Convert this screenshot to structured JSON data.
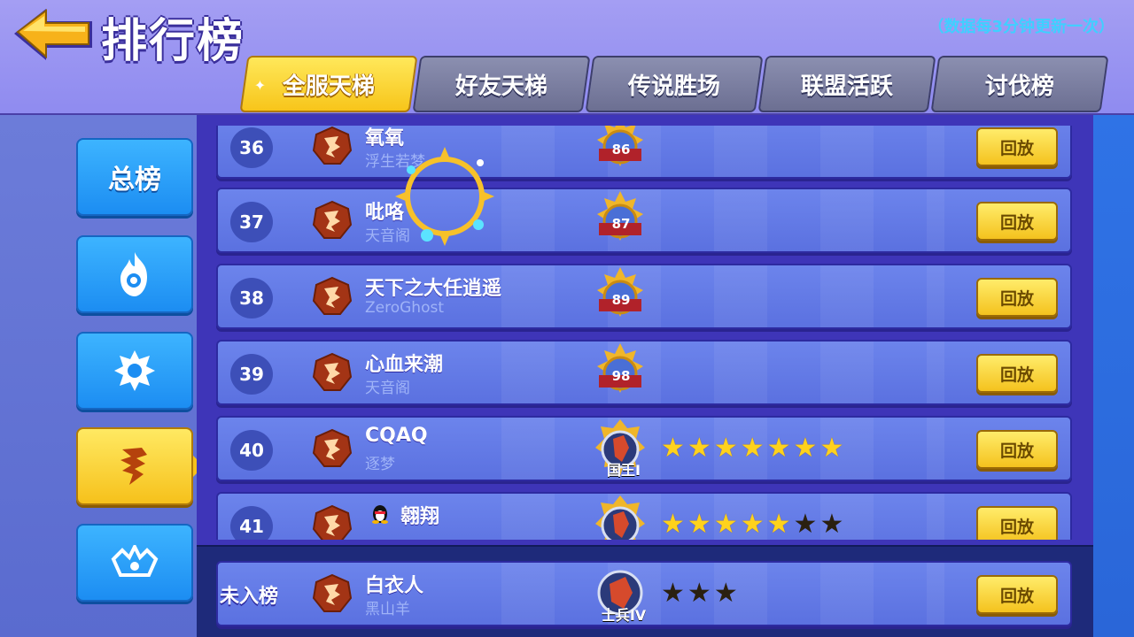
{
  "header": {
    "title": "排行榜",
    "update_note": "（数据每3分钟更新一次）"
  },
  "tabs": [
    {
      "label": "全服天梯",
      "active": true
    },
    {
      "label": "好友天梯",
      "active": false
    },
    {
      "label": "传说胜场",
      "active": false
    },
    {
      "label": "联盟活跃",
      "active": false
    },
    {
      "label": "讨伐榜",
      "active": false
    }
  ],
  "sidebar": {
    "items": [
      {
        "label": "总榜",
        "icon": "total-ranking",
        "active": false
      },
      {
        "label": "",
        "icon": "flame-class-icon",
        "active": false
      },
      {
        "label": "",
        "icon": "gear-class-icon",
        "active": false
      },
      {
        "label": "",
        "icon": "dragon-class-icon",
        "active": true
      },
      {
        "label": "",
        "icon": "crown-class-icon",
        "active": false
      }
    ]
  },
  "rows": [
    {
      "rank": "36",
      "name": "氧氧",
      "guild": "浮生若梦",
      "badge": "86",
      "stars": [],
      "replay": "回放"
    },
    {
      "rank": "37",
      "name": "吡咯",
      "guild": "天音阁",
      "badge": "87",
      "stars": [],
      "replay": "回放"
    },
    {
      "rank": "38",
      "name": "天下之大任逍遥",
      "guild": "ZeroGhost",
      "badge": "89",
      "stars": [],
      "replay": "回放"
    },
    {
      "rank": "39",
      "name": "心血来潮",
      "guild": "天音阁",
      "badge": "98",
      "stars": [],
      "replay": "回放"
    },
    {
      "rank": "40",
      "name": "CQAQ",
      "guild": "逐梦",
      "badge": "国王I",
      "stars": [
        1,
        1,
        1,
        1,
        1,
        1,
        1
      ],
      "replay": "回放"
    },
    {
      "rank": "41",
      "name": "翱翔",
      "guild": "",
      "badge": "",
      "stars": [
        1,
        1,
        1,
        1,
        1,
        0,
        0
      ],
      "replay": "回放"
    }
  ],
  "my_row": {
    "rank": "未入榜",
    "name": "白衣人",
    "guild": "黑山羊",
    "badge": "士兵IV",
    "stars": [
      0,
      0,
      0
    ],
    "replay": "回放"
  },
  "colors": {
    "accent_yellow": "#f7c51a",
    "tab_blue": "#1c8df2",
    "row_blue": "#6c84ec",
    "note_cyan": "#3fd0ff"
  }
}
